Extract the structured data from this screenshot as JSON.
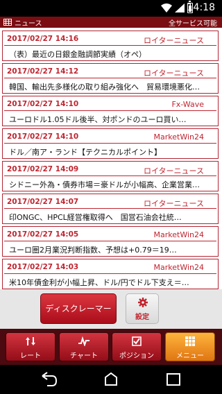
{
  "status_bar": {
    "time": "14:18"
  },
  "header": {
    "title": "ニュース",
    "status": "全サービス可能"
  },
  "news": [
    {
      "datetime": "2017/02/27 14:16",
      "source": "ロイターニュース",
      "headline": "（表）最近の日銀金融調節実績（オペ）"
    },
    {
      "datetime": "2017/02/27 14:12",
      "source": "ロイターニュース",
      "headline": "韓国、輸出先多様化の取り組み強化へ　貿易環境悪化…"
    },
    {
      "datetime": "2017/02/27 14:10",
      "source": "Fx-Wave",
      "headline": "ユーロドル1.05ドル後半、対ポンドのユーロ買い…"
    },
    {
      "datetime": "2017/02/27 14:10",
      "source": "MarketWin24",
      "headline": "ドル／南ア・ランド【テクニカルポイント】"
    },
    {
      "datetime": "2017/02/27 14:09",
      "source": "ロイターニュース",
      "headline": "シドニー外為・債券市場＝豪ドルが小幅高、企業営業…"
    },
    {
      "datetime": "2017/02/27 14:07",
      "source": "ロイターニュース",
      "headline": "印ONGC、HPCL経営権取得へ　国営石油会社統…"
    },
    {
      "datetime": "2017/02/27 14:05",
      "source": "MarketWin24",
      "headline": "ユーロ圏2月業況判断指数、予想は+0.79＝19…"
    },
    {
      "datetime": "2017/02/27 14:03",
      "source": "MarketWin24",
      "headline": "米10年債金利が小幅上昇、ドル/円でドル下支え＝…"
    }
  ],
  "actions": {
    "disclaimer_label": "ディスクレーマー",
    "settings_label": "設定"
  },
  "tabs": [
    {
      "label": "レート",
      "icon": "arrows-updown-icon",
      "active": false
    },
    {
      "label": "チャート",
      "icon": "chart-line-icon",
      "active": false
    },
    {
      "label": "ポジション",
      "icon": "checkbox-icon",
      "active": false
    },
    {
      "label": "メニュー",
      "icon": "grid-icon",
      "active": true
    }
  ],
  "colors": {
    "accent": "#c0242f",
    "header_bg": "#7a0d12",
    "tab_bg": "#b71c28",
    "tab_active": "#f39a28"
  }
}
